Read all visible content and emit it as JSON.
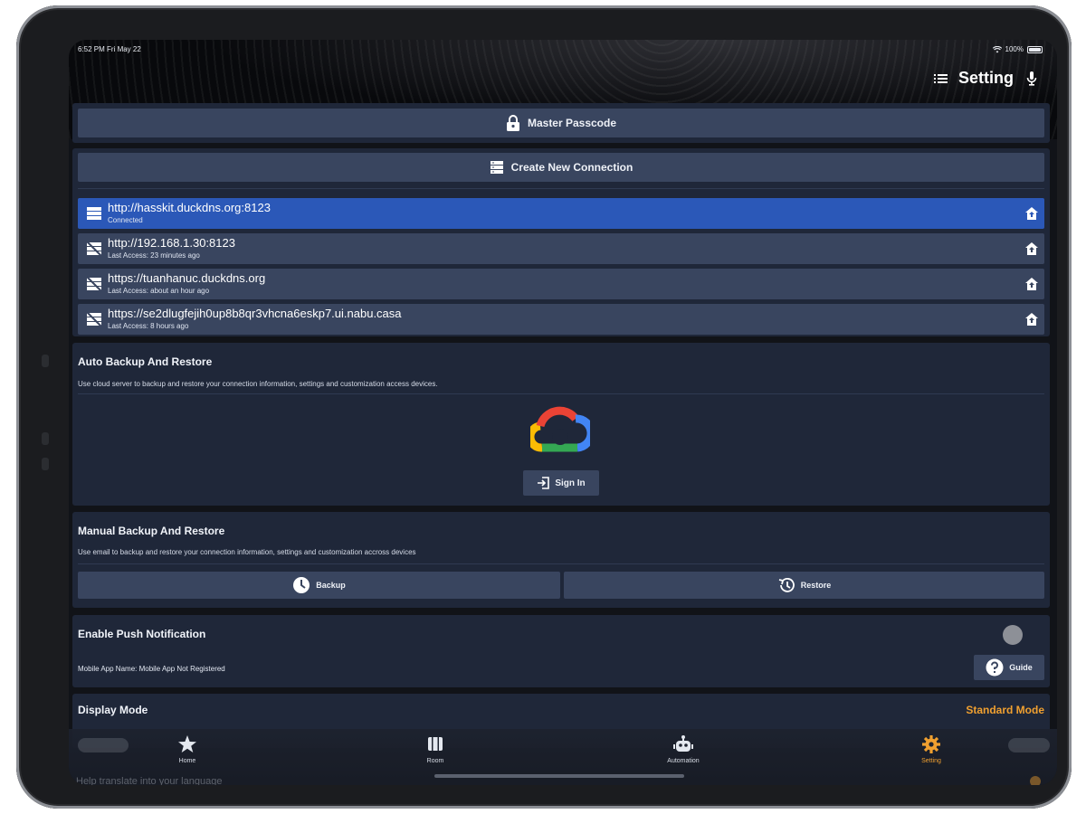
{
  "status_bar": {
    "time": "6:52 PM   Fri May 22",
    "battery": "100%"
  },
  "header": {
    "title": "Setting",
    "menu_icon": "menu-icon",
    "action_icon": "microphone-icon"
  },
  "master_passcode": {
    "label": "Master Passcode",
    "icon": "lock-icon"
  },
  "create_connection": {
    "label": "Create New Connection",
    "icon": "server-icon"
  },
  "connections": [
    {
      "url": "http://hasskit.duckdns.org:8123",
      "status": "Connected",
      "active": true
    },
    {
      "url": "http://192.168.1.30:8123",
      "status": "Last Access: 23 minutes ago",
      "active": false
    },
    {
      "url": "https://tuanhanuc.duckdns.org",
      "status": "Last Access: about an hour ago",
      "active": false
    },
    {
      "url": "https://se2dlugfejih0up8b8qr3vhcna6eskp7.ui.nabu.casa",
      "status": "Last Access: 8 hours ago",
      "active": false
    }
  ],
  "auto_backup": {
    "title": "Auto Backup And Restore",
    "description": "Use cloud server to backup and restore your connection information, settings and customization access devices.",
    "logo": "google-cloud-logo",
    "signin_label": "Sign In"
  },
  "manual_backup": {
    "title": "Manual Backup And Restore",
    "description": "Use email to backup and restore your connection information, settings and customization accross devices",
    "backup_label": "Backup",
    "restore_label": "Restore"
  },
  "push_notification": {
    "title": "Enable Push Notification",
    "mobile_app_label": "Mobile App Name: Mobile App Not Registered",
    "guide_label": "Guide",
    "enabled": false
  },
  "display_mode": {
    "title": "Display Mode",
    "value": "Standard Mode"
  },
  "partial_text": "Help translate into your language",
  "tabs": [
    {
      "label": "Home",
      "icon": "star-icon",
      "active": false
    },
    {
      "label": "Room",
      "icon": "room-icon",
      "active": false
    },
    {
      "label": "Automation",
      "icon": "robot-icon",
      "active": false
    },
    {
      "label": "Setting",
      "icon": "gear-icon",
      "active": true
    }
  ],
  "colors": {
    "background": "#111318",
    "card": "#1f2739",
    "button": "#39455f",
    "active_connection": "#2b58b8",
    "accent": "#f0a030"
  }
}
